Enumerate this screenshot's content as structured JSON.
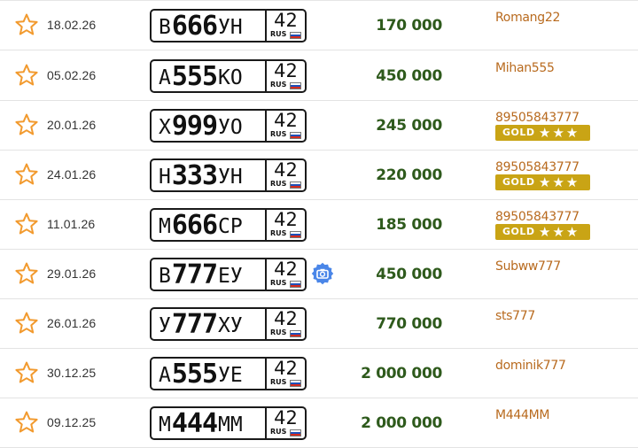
{
  "colors": {
    "accent_orange": "#f29a2e",
    "price_green": "#2e5a1c",
    "seller_link": "#b86a1e",
    "gold_badge": "#c9a415",
    "camera_blue": "#4a86e8"
  },
  "icons": {
    "favorite": "star-outline-icon",
    "photo": "camera-icon",
    "flag": "russian-flag-icon"
  },
  "listings": [
    {
      "date": "18.02.26",
      "plate": {
        "l1": "В",
        "num": "666",
        "l2": "УН",
        "region": "42",
        "country": "RUS"
      },
      "price": "170 000",
      "seller": "Romang22",
      "gold": false,
      "has_photo": false
    },
    {
      "date": "05.02.26",
      "plate": {
        "l1": "А",
        "num": "555",
        "l2": "КО",
        "region": "42",
        "country": "RUS"
      },
      "price": "450 000",
      "seller": "Mihan555",
      "gold": false,
      "has_photo": false
    },
    {
      "date": "20.01.26",
      "plate": {
        "l1": "Х",
        "num": "999",
        "l2": "УО",
        "region": "42",
        "country": "RUS"
      },
      "price": "245 000",
      "seller": "89505843777",
      "gold": true,
      "has_photo": false
    },
    {
      "date": "24.01.26",
      "plate": {
        "l1": "Н",
        "num": "333",
        "l2": "УН",
        "region": "42",
        "country": "RUS"
      },
      "price": "220 000",
      "seller": "89505843777",
      "gold": true,
      "has_photo": false
    },
    {
      "date": "11.01.26",
      "plate": {
        "l1": "М",
        "num": "666",
        "l2": "СР",
        "region": "42",
        "country": "RUS"
      },
      "price": "185 000",
      "seller": "89505843777",
      "gold": true,
      "has_photo": false
    },
    {
      "date": "29.01.26",
      "plate": {
        "l1": "В",
        "num": "777",
        "l2": "ЕУ",
        "region": "42",
        "country": "RUS"
      },
      "price": "450 000",
      "seller": "Subww777",
      "gold": false,
      "has_photo": true
    },
    {
      "date": "26.01.26",
      "plate": {
        "l1": "У",
        "num": "777",
        "l2": "ХУ",
        "region": "42",
        "country": "RUS"
      },
      "price": "770 000",
      "seller": "sts777",
      "gold": false,
      "has_photo": false
    },
    {
      "date": "30.12.25",
      "plate": {
        "l1": "А",
        "num": "555",
        "l2": "УЕ",
        "region": "42",
        "country": "RUS"
      },
      "price": "2 000 000",
      "seller": "dominik777",
      "gold": false,
      "has_photo": false
    },
    {
      "date": "09.12.25",
      "plate": {
        "l1": "М",
        "num": "444",
        "l2": "ММ",
        "region": "42",
        "country": "RUS"
      },
      "price": "2 000 000",
      "seller": "M444MM",
      "gold": false,
      "has_photo": false
    }
  ],
  "badge": {
    "label": "GOLD",
    "stars": "★★★"
  }
}
